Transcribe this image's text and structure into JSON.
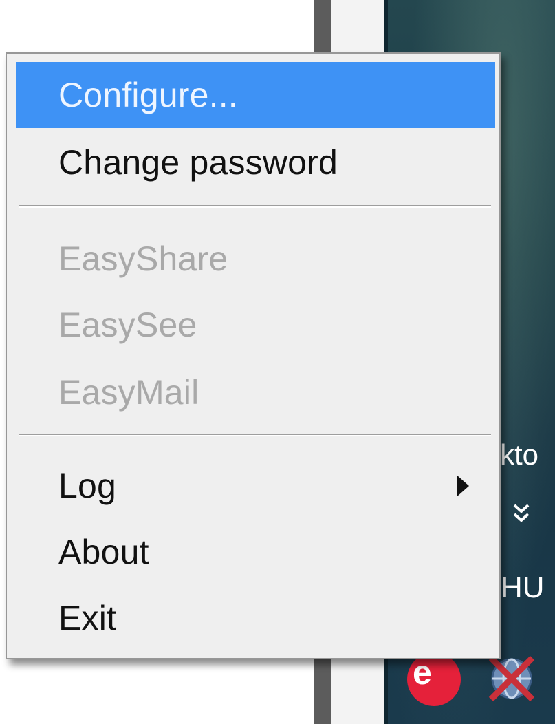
{
  "menu": {
    "items": [
      {
        "label": "Configure...",
        "state": "highlighted"
      },
      {
        "label": "Change password",
        "state": "normal"
      },
      {
        "label": "EasyShare",
        "state": "disabled"
      },
      {
        "label": "EasySee",
        "state": "disabled"
      },
      {
        "label": "EasyMail",
        "state": "disabled"
      },
      {
        "label": "Log",
        "state": "normal",
        "has_submenu": true
      },
      {
        "label": "About",
        "state": "normal"
      },
      {
        "label": "Exit",
        "state": "normal"
      }
    ],
    "highlight_color": "#3e92f5"
  },
  "desktop": {
    "partial_label": "skto",
    "language_indicator": "HU",
    "tray_icons": [
      "express-e-icon",
      "network-disconnected-icon"
    ],
    "overflow_chevron": "double-chevron-down-icon"
  },
  "colors": {
    "menu_background": "#efefef",
    "menu_border": "#979797",
    "disabled_text": "#a9a9a9",
    "tray_red": "#e5213a"
  }
}
